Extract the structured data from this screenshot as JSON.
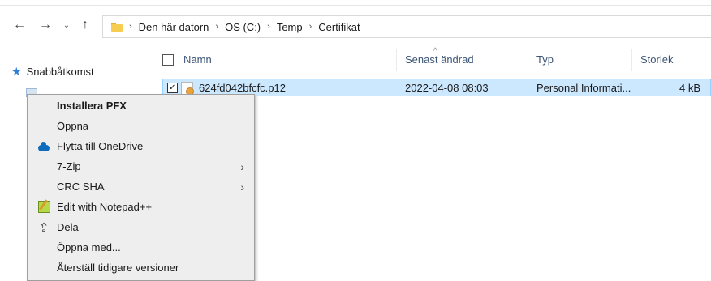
{
  "nav": {
    "back_glyph": "←",
    "forward_glyph": "→",
    "recent_glyph": "⌄",
    "up_glyph": "↑"
  },
  "breadcrumb": {
    "separator": "›",
    "items": [
      "Den här datorn",
      "OS (C:)",
      "Temp",
      "Certifikat"
    ]
  },
  "sidebar": {
    "quick_access": "Snabbåtkomst"
  },
  "columns": {
    "name": "Namn",
    "modified": "Senast ändrad",
    "type": "Typ",
    "size": "Storlek",
    "sort_glyph": "^"
  },
  "files": [
    {
      "name": "624fd042bfcfc.p12",
      "modified": "2022-04-08 08:03",
      "type": "Personal Informati...",
      "size": "4 kB",
      "selected": true,
      "checked_glyph": "✓"
    }
  ],
  "context_menu": {
    "items": [
      {
        "label": "Installera PFX",
        "icon": "",
        "default": true
      },
      {
        "label": "Öppna",
        "icon": ""
      },
      {
        "label": "Flytta till OneDrive",
        "icon": "onedrive-cloud-icon"
      },
      {
        "label": "7-Zip",
        "icon": "",
        "submenu": true
      },
      {
        "label": "CRC SHA",
        "icon": "",
        "submenu": true
      },
      {
        "label": "Edit with Notepad++",
        "icon": "notepad-plus-plus-icon"
      },
      {
        "label": "Dela",
        "icon": "share-icon"
      },
      {
        "label": "Öppna med...",
        "icon": ""
      },
      {
        "label": "Återställ tidigare versioner",
        "icon": ""
      }
    ],
    "submenu_glyph": "›"
  },
  "colors": {
    "selection_bg": "#cce8ff",
    "selection_border": "#99d1ff",
    "menu_bg": "#eeeeee",
    "header_text": "#3d5676",
    "folder_yellow": "#f6cd4f",
    "onedrive_blue": "#0f6cbd"
  }
}
